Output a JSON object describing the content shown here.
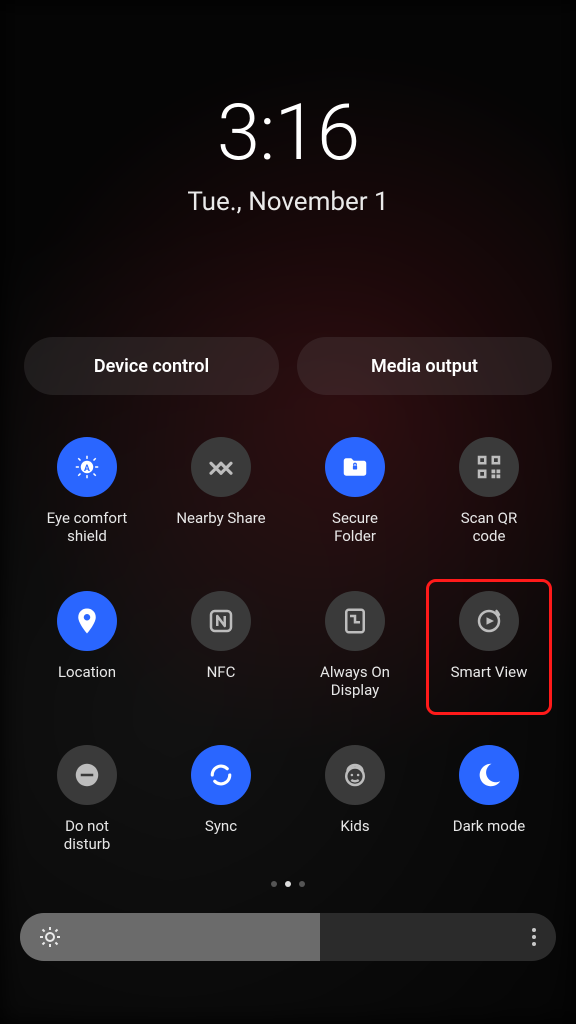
{
  "clock": {
    "time": "3:16",
    "date": "Tue., November 1"
  },
  "deck": {
    "device_control": "Device control",
    "media_output": "Media output"
  },
  "tiles": [
    {
      "label": "Eye comfort\nshield",
      "icon": "eye-comfort-icon",
      "active": true
    },
    {
      "label": "Nearby Share",
      "icon": "nearby-share-icon",
      "active": false
    },
    {
      "label": "Secure\nFolder",
      "icon": "secure-folder-icon",
      "active": true
    },
    {
      "label": "Scan QR\ncode",
      "icon": "qr-code-icon",
      "active": false
    },
    {
      "label": "Location",
      "icon": "location-icon",
      "active": true
    },
    {
      "label": "NFC",
      "icon": "nfc-icon",
      "active": false
    },
    {
      "label": "Always On\nDisplay",
      "icon": "aod-icon",
      "active": false
    },
    {
      "label": "Smart View",
      "icon": "smart-view-icon",
      "active": false,
      "highlight": true
    },
    {
      "label": "Do not\ndisturb",
      "icon": "dnd-icon",
      "active": false
    },
    {
      "label": "Sync",
      "icon": "sync-icon",
      "active": true
    },
    {
      "label": "Kids",
      "icon": "kids-icon",
      "active": false
    },
    {
      "label": "Dark mode",
      "icon": "dark-mode-icon",
      "active": true
    }
  ],
  "pager": {
    "count": 3,
    "active_index": 1
  },
  "brightness": {
    "percent": 56
  }
}
